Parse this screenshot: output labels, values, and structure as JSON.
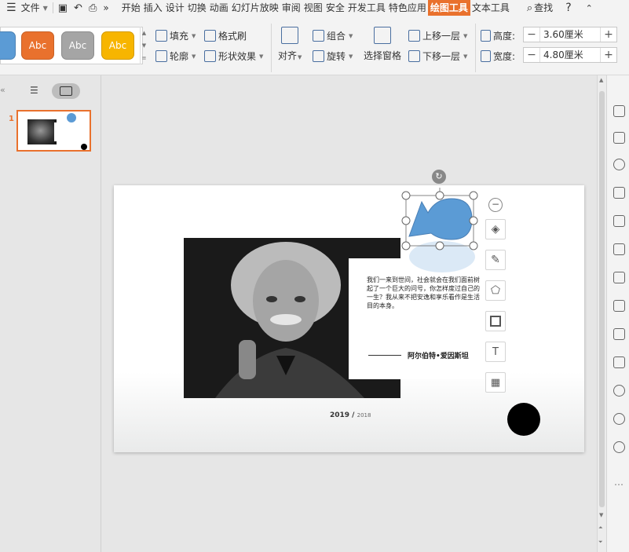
{
  "menubar": {
    "file_label": "文件",
    "tabs": [
      "开始",
      "插入",
      "设计",
      "切换",
      "动画",
      "幻灯片放映",
      "审阅",
      "视图",
      "安全",
      "开发工具",
      "特色应用",
      "绘图工具",
      "文本工具"
    ],
    "active_tab": "绘图工具",
    "search_label": "查找"
  },
  "ribbon": {
    "style_presets": [
      {
        "label": "Abc",
        "color": "#e9712d"
      },
      {
        "label": "Abc",
        "color": "#a5a5a5"
      },
      {
        "label": "Abc",
        "color": "#f7b500"
      }
    ],
    "fill_label": "填充",
    "format_painter_label": "格式刷",
    "outline_label": "轮廓",
    "shape_effect_label": "形状效果",
    "align_label": "对齐",
    "group_label": "组合",
    "rotate_label": "旋转",
    "selection_pane_label": "选择窗格",
    "bring_forward_label": "上移一层",
    "send_backward_label": "下移一层",
    "height_label": "高度:",
    "height_value": "3.60厘米",
    "width_label": "宽度:",
    "width_value": "4.80厘米"
  },
  "thumbnails": {
    "slide_number": "1"
  },
  "slide": {
    "quote": "我们一来到世间，社会就会在我们面前树起了一个巨大的问号，你怎样度过自己的一生？我从来不把安逸和享乐看作是生活目的本身。",
    "author": "阿尔伯特•爱因斯坦",
    "year_main": "2019 /",
    "year_sub": "2018",
    "shape_color": "#5b9bd5"
  }
}
